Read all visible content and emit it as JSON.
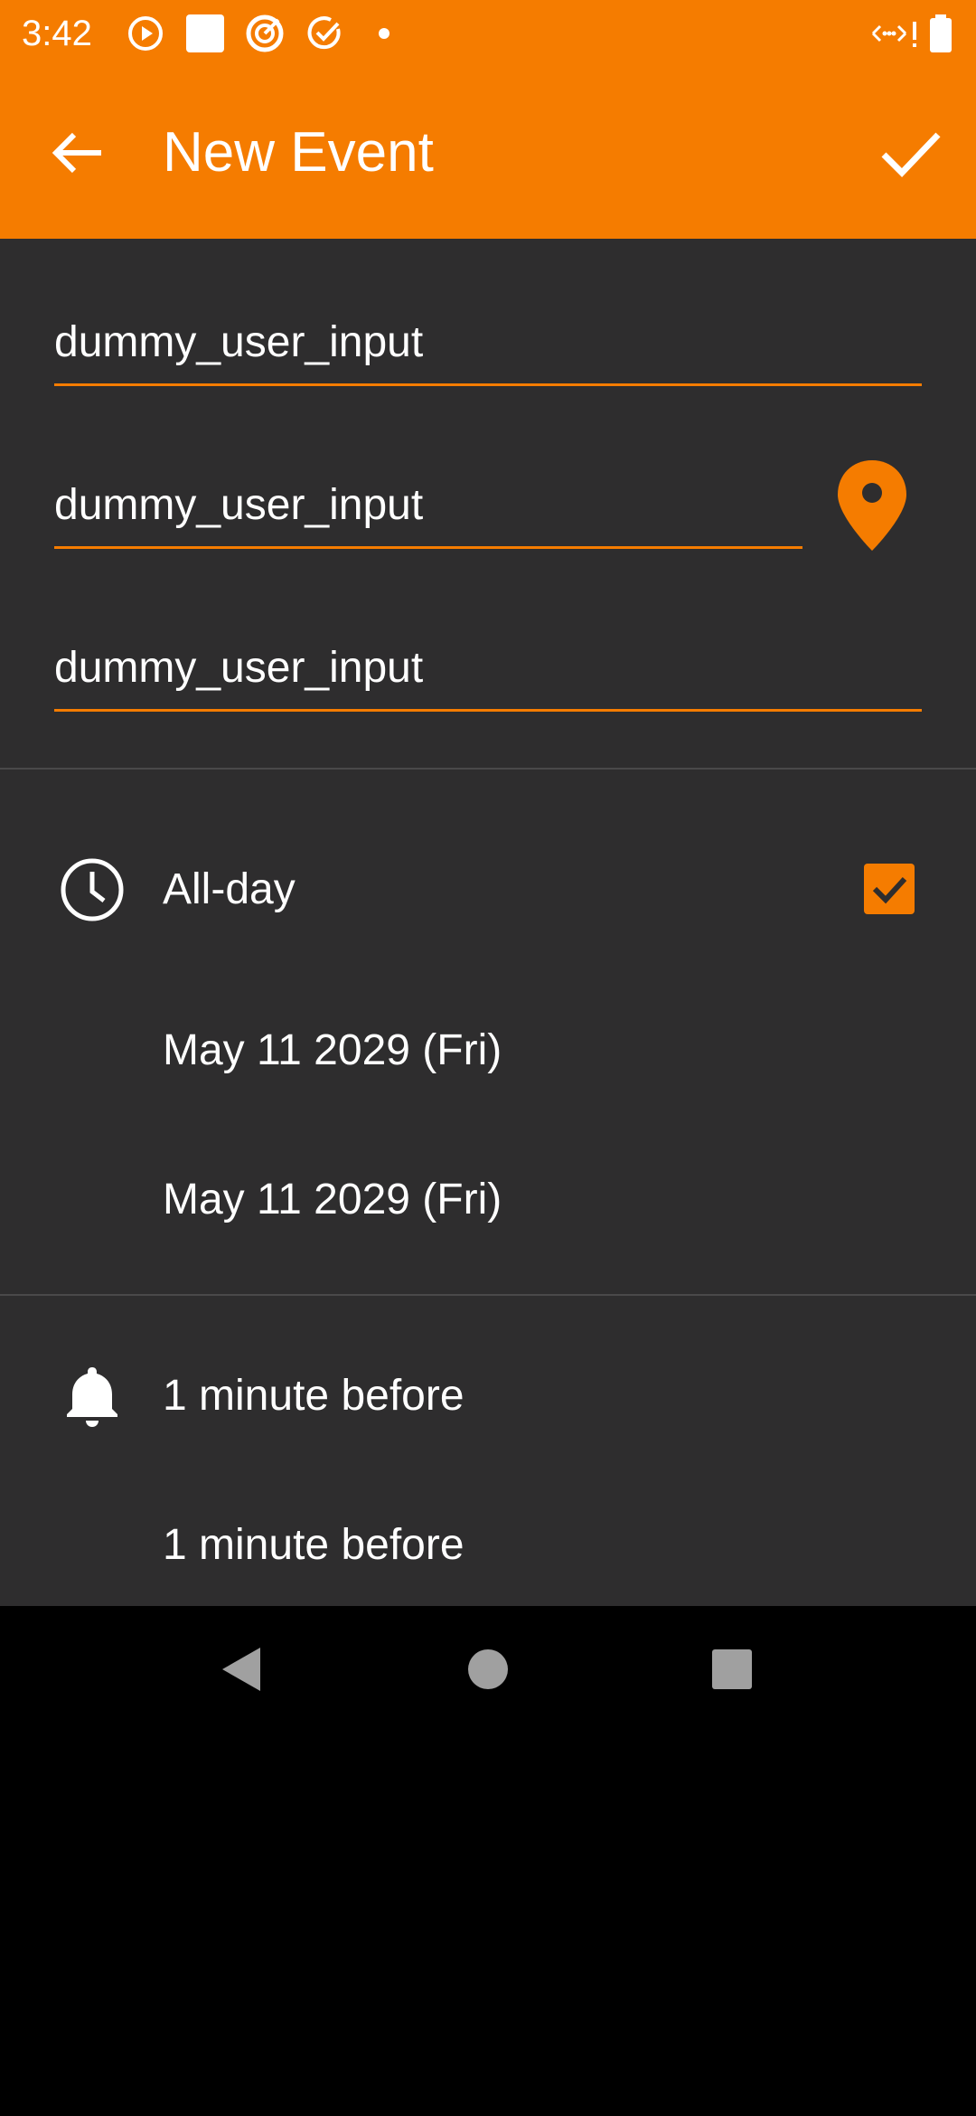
{
  "status_bar": {
    "time": "3:42",
    "icons": [
      "play-circle-icon",
      "square-icon",
      "target-icon",
      "check-circle-icon",
      "dot-icon",
      "network-icon",
      "battery-icon"
    ]
  },
  "app_bar": {
    "title": "New Event",
    "back_icon": "arrow-left-icon",
    "save_icon": "check-icon"
  },
  "form": {
    "title_value": "dummy_user_input",
    "location_value": "dummy_user_input",
    "description_value": "dummy_user_input",
    "location_icon": "map-pin-icon"
  },
  "all_day": {
    "label": "All-day",
    "checked": true,
    "icon": "clock-icon"
  },
  "dates": {
    "start": "May 11 2029 (Fri)",
    "end": "May 11 2029 (Fri)"
  },
  "reminders": {
    "icon": "bell-icon",
    "first": "1 minute before",
    "second": "1 minute before"
  },
  "colors": {
    "accent": "#F57C00",
    "background": "#2E2D2E",
    "text": "#FFFFFF"
  }
}
